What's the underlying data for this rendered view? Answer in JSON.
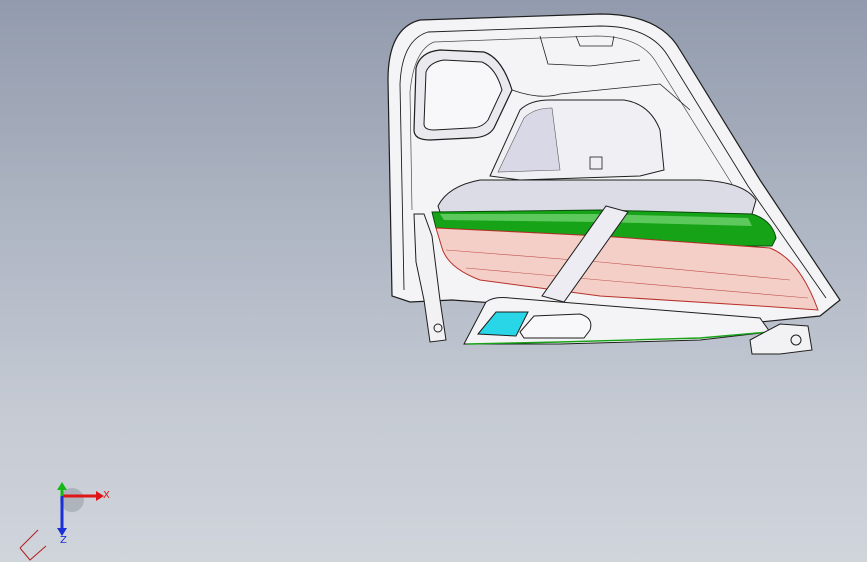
{
  "viewport": {
    "background_top": "#929bad",
    "background_bottom": "#d0d4db"
  },
  "model": {
    "colors": {
      "edge": "#1e1e1e",
      "panel_face": "#f4f4f6",
      "panel_shade": "#dcdce6",
      "armrest_green": "#17a317",
      "armrest_green_light": "#6fd26f",
      "lower_pad_pink": "#f4cfc8",
      "lower_pad_edge": "#b8312a",
      "pocket_cyan": "#29d6e8"
    }
  },
  "triad": {
    "x_label": "X",
    "y_label": "Y",
    "z_label": "Z",
    "x_color": "#e01616",
    "y_color": "#15b815",
    "z_color": "#1a2fd6"
  }
}
